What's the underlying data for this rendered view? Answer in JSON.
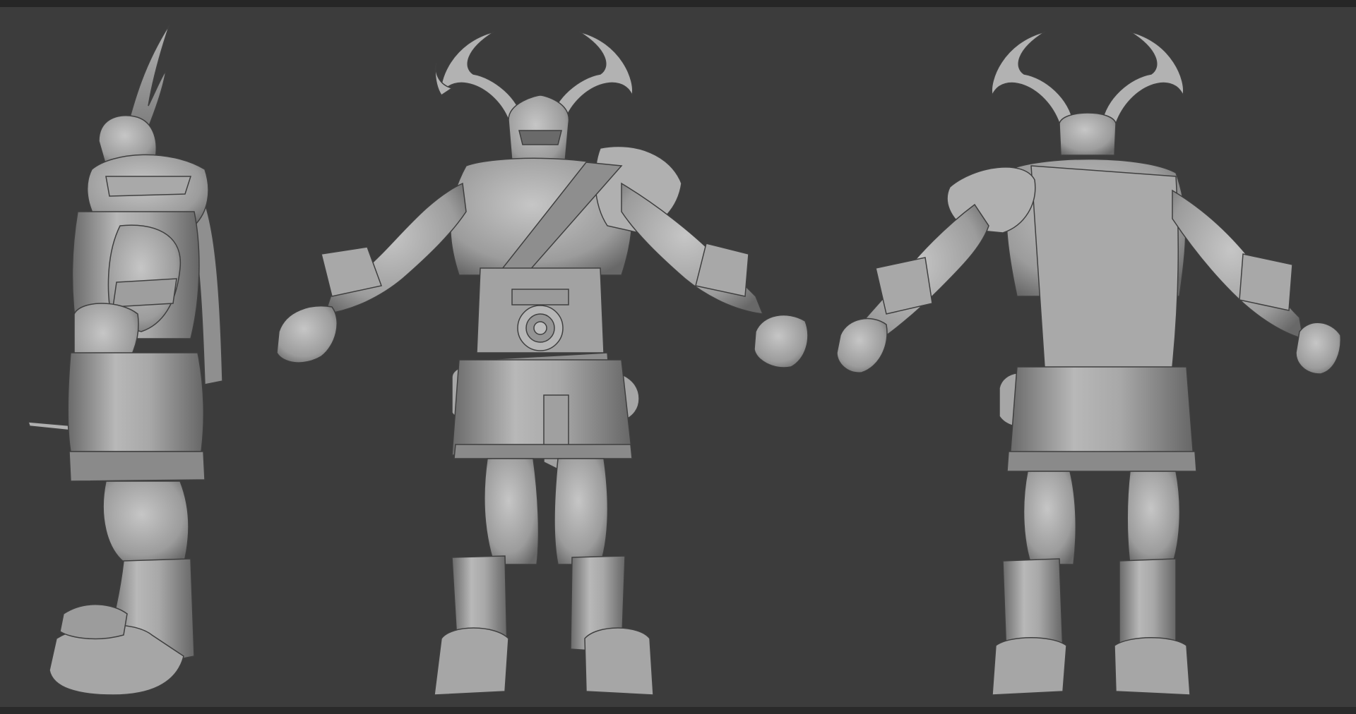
{
  "scene": {
    "background": "#3c3c3c",
    "clay": "#9a9a9a",
    "clay_light": "#c4c4c4",
    "clay_dark": "#5e5e5e",
    "views": [
      "side",
      "front",
      "back"
    ]
  }
}
